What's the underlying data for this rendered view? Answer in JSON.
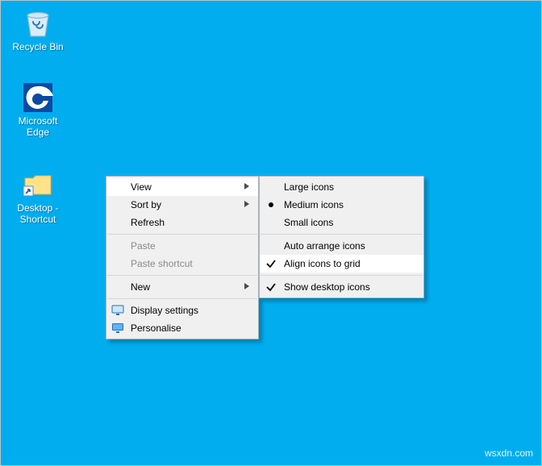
{
  "desktop_icons": {
    "recycle_bin": {
      "label": "Recycle Bin"
    },
    "edge": {
      "label": "Microsoft\nEdge"
    },
    "shortcut": {
      "label": "Desktop -\nShortcut"
    }
  },
  "ctx_main": {
    "view": "View",
    "sort_by": "Sort by",
    "refresh": "Refresh",
    "paste": "Paste",
    "paste_shortcut": "Paste shortcut",
    "new": "New",
    "display_settings": "Display settings",
    "personalise": "Personalise"
  },
  "ctx_view": {
    "large": "Large icons",
    "medium": "Medium icons",
    "small": "Small icons",
    "auto_arrange": "Auto arrange icons",
    "align_grid": "Align icons to grid",
    "show_icons": "Show desktop icons"
  },
  "watermark": "wsxdn.com"
}
